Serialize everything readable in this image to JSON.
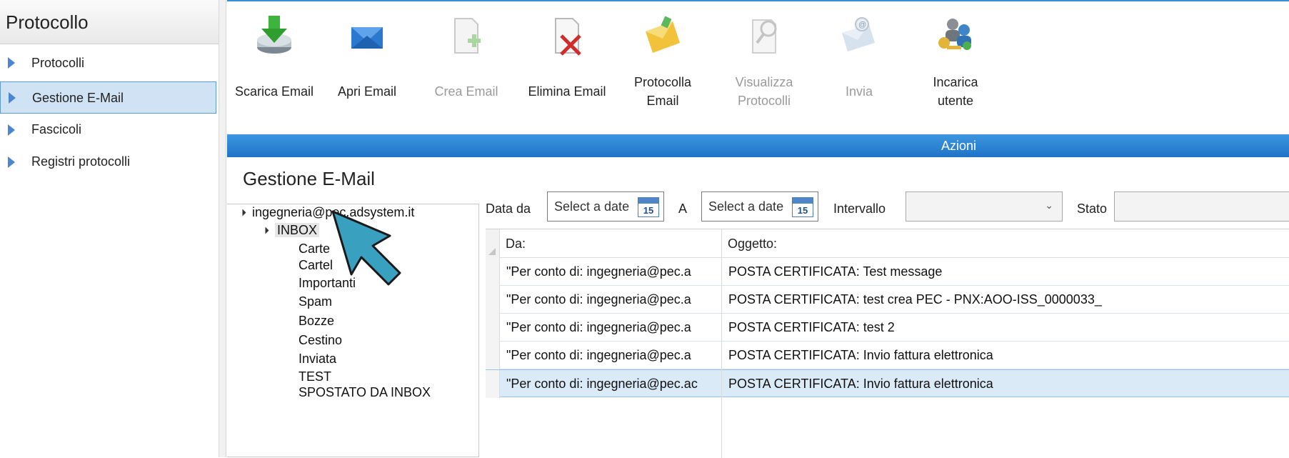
{
  "sidebar": {
    "title": "Protocollo",
    "items": [
      {
        "label": "Protocolli"
      },
      {
        "label": "Gestione E-Mail"
      },
      {
        "label": "Fascicoli"
      },
      {
        "label": "Registri protocolli"
      }
    ]
  },
  "ribbon": {
    "buttons": [
      {
        "line1": "Scarica Email",
        "line2": "",
        "icon": "download-drive-icon",
        "enabled": true
      },
      {
        "line1": "Apri Email",
        "line2": "",
        "icon": "open-envelope-icon",
        "enabled": true
      },
      {
        "line1": "Crea Email",
        "line2": "",
        "icon": "new-document-icon",
        "enabled": false
      },
      {
        "line1": "Elimina Email",
        "line2": "",
        "icon": "delete-document-icon",
        "enabled": true
      },
      {
        "line1": "Protocolla",
        "line2": "Email",
        "icon": "yellow-envelope-icon",
        "enabled": true
      },
      {
        "line1": "Visualizza",
        "line2": "Protocolli",
        "icon": "search-document-icon",
        "enabled": false
      },
      {
        "line1": "Invia",
        "line2": "",
        "icon": "send-email-icon",
        "enabled": false
      },
      {
        "line1": "Incarica",
        "line2": "utente",
        "icon": "users-key-icon",
        "enabled": true
      }
    ],
    "group_label": "Azioni"
  },
  "page": {
    "title": "Gestione E-Mail"
  },
  "tree": {
    "account": "ingegneria@pec.adsystem.it",
    "inbox": "INBOX",
    "folders": [
      "Carte",
      "Cartel",
      "Importanti",
      "Spam",
      "Bozze",
      "Cestino",
      "Inviata",
      "TEST",
      "SPOSTATO DA INBOX"
    ]
  },
  "filters": {
    "date_from_label": "Data da",
    "date_from_placeholder": "Select a date",
    "date_to_label": "A",
    "date_to_placeholder": "Select a date",
    "calendar_day": "15",
    "interval_label": "Intervallo",
    "interval_value": "",
    "status_label": "Stato"
  },
  "grid": {
    "columns": [
      "Da:",
      "Oggetto:"
    ],
    "rows": [
      {
        "from": "\"Per conto di: ingegneria@pec.a",
        "subject": "POSTA CERTIFICATA: Test message"
      },
      {
        "from": "\"Per conto di: ingegneria@pec.a",
        "subject": "POSTA CERTIFICATA: test crea PEC - PNX:AOO-ISS_0000033_"
      },
      {
        "from": "\"Per conto di: ingegneria@pec.a",
        "subject": "POSTA CERTIFICATA: test 2"
      },
      {
        "from": "\"Per conto di: ingegneria@pec.a",
        "subject": "POSTA CERTIFICATA: Invio fattura elettronica"
      },
      {
        "from": "\"Per conto di: ingegneria@pec.ac",
        "subject": "POSTA CERTIFICATA: Invio fattura elettronica",
        "selected": true
      }
    ]
  },
  "colors": {
    "accent": "#2a82d4",
    "selection": "#cfe3f5",
    "pointer": "#3aa0c0"
  }
}
